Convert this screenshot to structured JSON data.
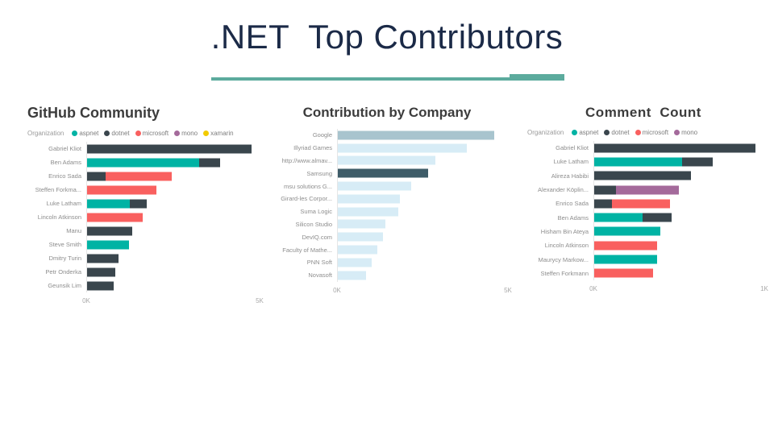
{
  "slide": {
    "title": ".NET  Top Contributors",
    "accent_color": "#5cab9d",
    "title_color": "#1b2a47"
  },
  "palette": {
    "aspnet": "#00b3a4",
    "dotnet": "#3a464d",
    "microsoft": "#f9605f",
    "mono": "#a46a9b",
    "xamarin": "#f2cb00",
    "company_primary": "#a8c4ce",
    "company_light": "#d7ecf6",
    "company_highlight": "#3e5c68"
  },
  "chart_data": [
    {
      "id": "github-community",
      "type": "bar",
      "orientation": "horizontal",
      "stacked": true,
      "title": "GitHub Community",
      "xlabel": "",
      "ylabel": "",
      "xlim": [
        0,
        5000
      ],
      "ticks": [
        "0K",
        "5K"
      ],
      "tick_values": [
        0,
        5000
      ],
      "grid": false,
      "legend": {
        "title": "Organization",
        "position": "top",
        "entries": [
          {
            "label": "aspnet",
            "color": "#00b3a4"
          },
          {
            "label": "dotnet",
            "color": "#3a464d"
          },
          {
            "label": "microsoft",
            "color": "#f9605f"
          },
          {
            "label": "mono",
            "color": "#a46a9b"
          },
          {
            "label": "xamarin",
            "color": "#f2cb00"
          }
        ]
      },
      "categories": [
        "Gabriel Kliot",
        "Ben Adams",
        "Enrico Sada",
        "Steffen Forkma...",
        "Luke Latham",
        "Lincoln Atkinson",
        "Manu",
        "Steve Smith",
        "Dmitry Turin",
        "Petr Onderka",
        "Geunsik Lim"
      ],
      "rows": [
        {
          "category": "Gabriel Kliot",
          "segments": [
            {
              "series": "dotnet",
              "value": 4760
            }
          ],
          "total": 4760
        },
        {
          "category": "Ben Adams",
          "segments": [
            {
              "series": "aspnet",
              "value": 3240
            },
            {
              "series": "dotnet",
              "value": 620
            }
          ],
          "total": 3860
        },
        {
          "category": "Enrico Sada",
          "segments": [
            {
              "series": "dotnet",
              "value": 540
            },
            {
              "series": "microsoft",
              "value": 1920
            }
          ],
          "total": 2460
        },
        {
          "category": "Steffen Forkma...",
          "segments": [
            {
              "series": "microsoft",
              "value": 2000
            }
          ],
          "total": 2000
        },
        {
          "category": "Luke Latham",
          "segments": [
            {
              "series": "aspnet",
              "value": 1240
            },
            {
              "series": "dotnet",
              "value": 480
            }
          ],
          "total": 1720
        },
        {
          "category": "Lincoln Atkinson",
          "segments": [
            {
              "series": "microsoft",
              "value": 1620
            }
          ],
          "total": 1620
        },
        {
          "category": "Manu",
          "segments": [
            {
              "series": "dotnet",
              "value": 1300
            }
          ],
          "total": 1300
        },
        {
          "category": "Steve Smith",
          "segments": [
            {
              "series": "aspnet",
              "value": 1220
            }
          ],
          "total": 1220
        },
        {
          "category": "Dmitry Turin",
          "segments": [
            {
              "series": "dotnet",
              "value": 900
            }
          ],
          "total": 900
        },
        {
          "category": "Petr Onderka",
          "segments": [
            {
              "series": "dotnet",
              "value": 820
            }
          ],
          "total": 820
        },
        {
          "category": "Geunsik Lim",
          "segments": [
            {
              "series": "dotnet",
              "value": 760
            }
          ],
          "total": 760
        }
      ]
    },
    {
      "id": "contribution-by-company",
      "type": "bar",
      "orientation": "horizontal",
      "stacked": false,
      "title": "Contribution by Company",
      "xlabel": "",
      "ylabel": "",
      "xlim": [
        0,
        5000
      ],
      "ticks": [
        "0K",
        "5K"
      ],
      "tick_values": [
        0,
        5000
      ],
      "grid": false,
      "categories": [
        "Google",
        "Illyriad Games",
        "http://www.almav...",
        "Samsung",
        "msu solutions G...",
        "Girard-les Corpor...",
        "Suma Logic",
        "Silicon Studio",
        "DevIQ.com",
        "Faculty of Mathe...",
        "PNN Soft",
        "Novasoft"
      ],
      "values": [
        4600,
        3800,
        2860,
        2660,
        2160,
        1830,
        1780,
        1400,
        1320,
        1160,
        1000,
        820
      ],
      "bar_colors": [
        "#a8c4ce",
        "#d7ecf6",
        "#d7ecf6",
        "#3e5c68",
        "#d7ecf6",
        "#d7ecf6",
        "#d7ecf6",
        "#d7ecf6",
        "#d7ecf6",
        "#d7ecf6",
        "#d7ecf6",
        "#d7ecf6"
      ]
    },
    {
      "id": "comment-count",
      "type": "bar",
      "orientation": "horizontal",
      "stacked": true,
      "title": "Comment  Count",
      "xlabel": "",
      "ylabel": "",
      "xlim": [
        0,
        1000
      ],
      "ticks": [
        "0K",
        "1K"
      ],
      "tick_values": [
        0,
        1000
      ],
      "grid": false,
      "legend": {
        "title": "Organization",
        "position": "top",
        "entries": [
          {
            "label": "aspnet",
            "color": "#00b3a4"
          },
          {
            "label": "dotnet",
            "color": "#3a464d"
          },
          {
            "label": "microsoft",
            "color": "#f9605f"
          },
          {
            "label": "mono",
            "color": "#a46a9b"
          }
        ]
      },
      "categories": [
        "Gabriel Kliot",
        "Luke Latham",
        "Alireza Habibi",
        "Alexander Köplin...",
        "Enrico Sada",
        "Ben Adams",
        "Hisham Bin Ateya",
        "Lincoln Atkinson",
        "Maurycy Markow...",
        "Steffen Forkmann"
      ],
      "rows": [
        {
          "category": "Gabriel Kliot",
          "segments": [
            {
              "series": "dotnet",
              "value": 950
            }
          ],
          "total": 950
        },
        {
          "category": "Luke Latham",
          "segments": [
            {
              "series": "aspnet",
              "value": 515
            },
            {
              "series": "dotnet",
              "value": 180
            }
          ],
          "total": 695
        },
        {
          "category": "Alireza Habibi",
          "segments": [
            {
              "series": "dotnet",
              "value": 570
            }
          ],
          "total": 570
        },
        {
          "category": "Alexander Köplin...",
          "segments": [
            {
              "series": "dotnet",
              "value": 130
            },
            {
              "series": "mono",
              "value": 370
            }
          ],
          "total": 500
        },
        {
          "category": "Enrico Sada",
          "segments": [
            {
              "series": "dotnet",
              "value": 105
            },
            {
              "series": "microsoft",
              "value": 340
            }
          ],
          "total": 445
        },
        {
          "category": "Ben Adams",
          "segments": [
            {
              "series": "aspnet",
              "value": 285
            },
            {
              "series": "dotnet",
              "value": 170
            }
          ],
          "total": 455
        },
        {
          "category": "Hisham Bin Ateya",
          "segments": [
            {
              "series": "aspnet",
              "value": 390
            }
          ],
          "total": 390
        },
        {
          "category": "Lincoln Atkinson",
          "segments": [
            {
              "series": "microsoft",
              "value": 370
            }
          ],
          "total": 370
        },
        {
          "category": "Maurycy Markow...",
          "segments": [
            {
              "series": "aspnet",
              "value": 372
            }
          ],
          "total": 372
        },
        {
          "category": "Steffen Forkmann",
          "segments": [
            {
              "series": "microsoft",
              "value": 348
            }
          ],
          "total": 348
        }
      ]
    }
  ]
}
